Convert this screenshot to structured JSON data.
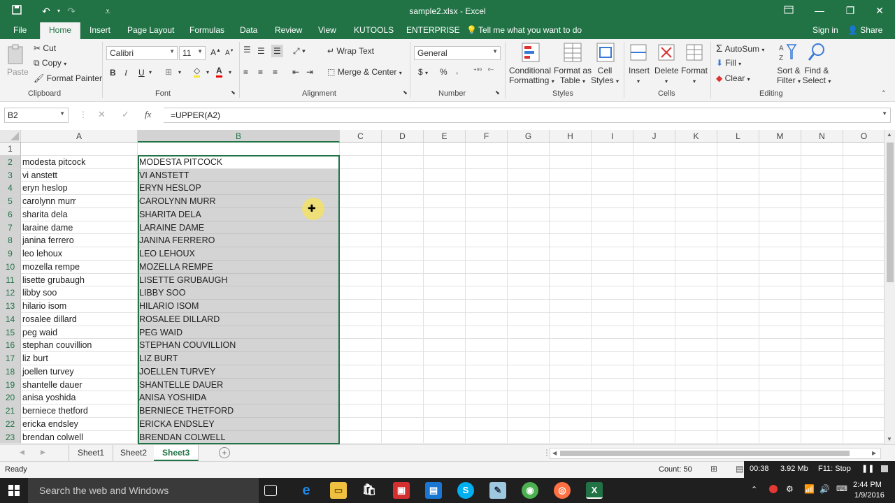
{
  "window": {
    "title": "sample2.xlsx - Excel",
    "accent": "#217346"
  },
  "tabs": [
    "File",
    "Home",
    "Insert",
    "Page Layout",
    "Formulas",
    "Data",
    "Review",
    "View",
    "KUTOOLS",
    "ENTERPRISE"
  ],
  "active_tab": "Home",
  "tell_me": "Tell me what you want to do",
  "account": {
    "signin": "Sign in",
    "share": "Share"
  },
  "ribbon": {
    "clipboard": {
      "label": "Clipboard",
      "paste": "Paste",
      "cut": "Cut",
      "copy": "Copy",
      "format_painter": "Format Painter"
    },
    "font": {
      "label": "Font",
      "name": "Calibri",
      "size": "11"
    },
    "alignment": {
      "label": "Alignment",
      "wrap": "Wrap Text",
      "merge": "Merge & Center"
    },
    "number": {
      "label": "Number",
      "format": "General"
    },
    "styles": {
      "label": "Styles",
      "conditional_1": "Conditional",
      "conditional_2": "Formatting",
      "format_as_1": "Format as",
      "format_as_2": "Table",
      "cell_styles_1": "Cell",
      "cell_styles_2": "Styles"
    },
    "cells": {
      "label": "Cells",
      "insert": "Insert",
      "delete": "Delete",
      "format": "Format"
    },
    "editing": {
      "label": "Editing",
      "autosum": "AutoSum",
      "fill": "Fill",
      "clear": "Clear",
      "sort_1": "Sort &",
      "sort_2": "Filter",
      "find_1": "Find &",
      "find_2": "Select"
    }
  },
  "formula_bar": {
    "name_box": "B2",
    "formula": "=UPPER(A2)"
  },
  "columns": [
    "A",
    "B",
    "C",
    "D",
    "E",
    "F",
    "G",
    "H",
    "I",
    "J",
    "K",
    "L",
    "M",
    "N",
    "O"
  ],
  "rows": [
    {
      "n": "1",
      "a": "",
      "b": ""
    },
    {
      "n": "2",
      "a": "modesta pitcock",
      "b": "MODESTA PITCOCK"
    },
    {
      "n": "3",
      "a": "vi anstett",
      "b": "VI ANSTETT"
    },
    {
      "n": "4",
      "a": "eryn heslop",
      "b": "ERYN HESLOP"
    },
    {
      "n": "5",
      "a": "carolynn murr",
      "b": "CAROLYNN MURR"
    },
    {
      "n": "6",
      "a": "sharita dela",
      "b": "SHARITA DELA"
    },
    {
      "n": "7",
      "a": "laraine dame",
      "b": "LARAINE DAME"
    },
    {
      "n": "8",
      "a": "janina ferrero",
      "b": "JANINA FERRERO"
    },
    {
      "n": "9",
      "a": "leo lehoux",
      "b": "LEO LEHOUX"
    },
    {
      "n": "10",
      "a": "mozella rempe",
      "b": "MOZELLA REMPE"
    },
    {
      "n": "11",
      "a": "lisette grubaugh",
      "b": "LISETTE GRUBAUGH"
    },
    {
      "n": "12",
      "a": "libby soo",
      "b": "LIBBY SOO"
    },
    {
      "n": "13",
      "a": "hilario isom",
      "b": "HILARIO ISOM"
    },
    {
      "n": "14",
      "a": "rosalee dillard",
      "b": "ROSALEE DILLARD"
    },
    {
      "n": "15",
      "a": "peg waid",
      "b": "PEG WAID"
    },
    {
      "n": "16",
      "a": "stephan couvillion",
      "b": "STEPHAN COUVILLION"
    },
    {
      "n": "17",
      "a": "liz burt",
      "b": "LIZ BURT"
    },
    {
      "n": "18",
      "a": "joellen turvey",
      "b": "JOELLEN TURVEY"
    },
    {
      "n": "19",
      "a": "shantelle dauer",
      "b": "SHANTELLE DAUER"
    },
    {
      "n": "20",
      "a": "anisa yoshida",
      "b": "ANISA YOSHIDA"
    },
    {
      "n": "21",
      "a": "berniece thetford",
      "b": "BERNIECE THETFORD"
    },
    {
      "n": "22",
      "a": "ericka endsley",
      "b": "ERICKA ENDSLEY"
    },
    {
      "n": "23",
      "a": "brendan colwell",
      "b": "BRENDAN COLWELL"
    }
  ],
  "sheets": [
    "Sheet1",
    "Sheet2",
    "Sheet3"
  ],
  "active_sheet": "Sheet3",
  "status": {
    "ready": "Ready",
    "count": "Count: 50"
  },
  "recorder": {
    "time": "00:38",
    "size": "3.92 Mb",
    "stop": "F11: Stop"
  },
  "taskbar": {
    "search_placeholder": "Search the web and Windows",
    "time": "2:44 PM",
    "date": "1/9/2016"
  }
}
